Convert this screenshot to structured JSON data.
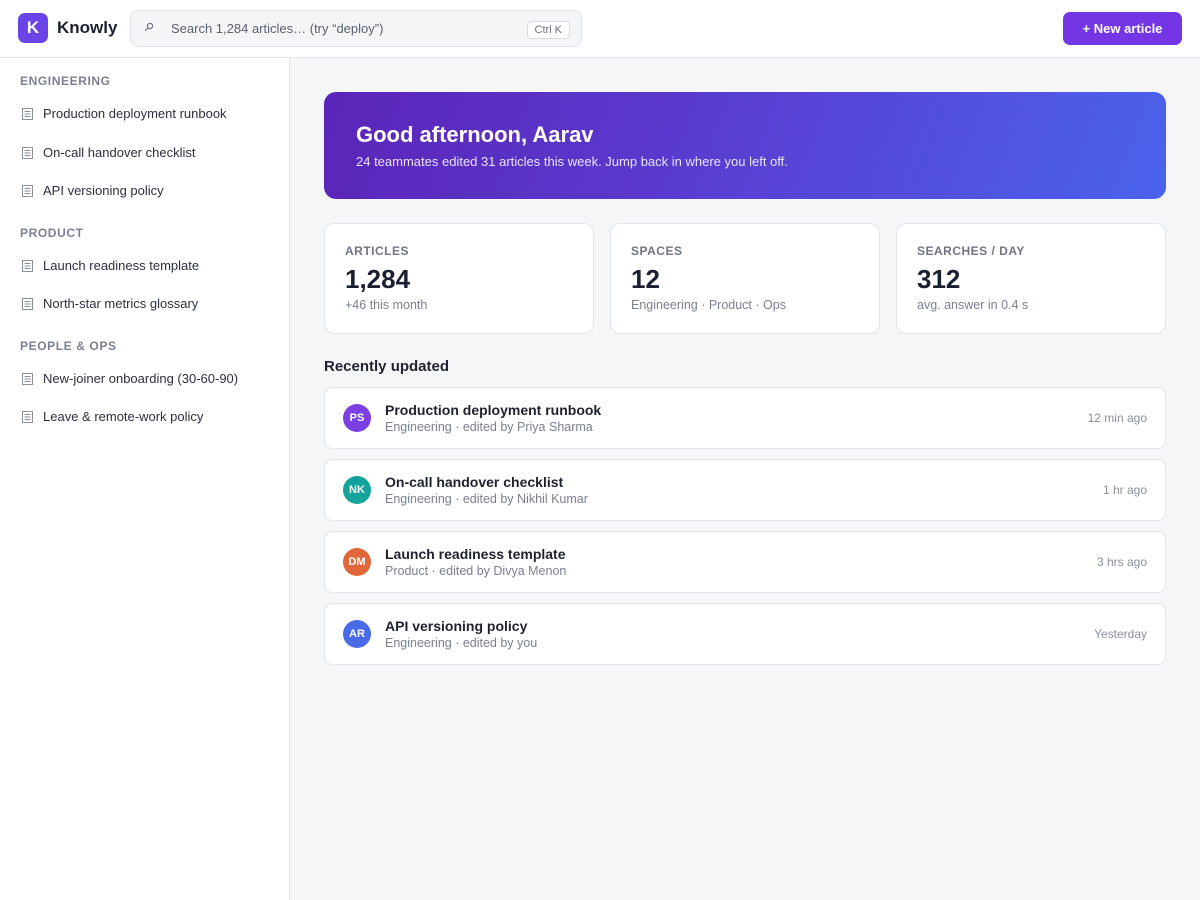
{
  "header": {
    "brand_initial": "K",
    "brand_name": "Knowly",
    "search_placeholder": "Search 1,284 articles…  (try “deploy”)",
    "search_shortcut": "Ctrl K",
    "new_article_label": "+ New article"
  },
  "sidebar": {
    "sections": [
      {
        "title": "ENGINEERING",
        "items": [
          "Production deployment runbook",
          "On-call handover checklist",
          "API versioning policy"
        ]
      },
      {
        "title": "PRODUCT",
        "items": [
          "Launch readiness template",
          "North-star metrics glossary"
        ]
      },
      {
        "title": "PEOPLE & OPS",
        "items": [
          "New-joiner onboarding (30-60-90)",
          "Leave & remote-work policy"
        ]
      }
    ]
  },
  "hero": {
    "title": "Good afternoon, Aarav",
    "subtitle": "24 teammates edited 31 articles this week. Jump back in where you left off."
  },
  "stats": [
    {
      "label": "ARTICLES",
      "value": "1,284",
      "sub": "+46 this month"
    },
    {
      "label": "SPACES",
      "value": "12",
      "sub": "Engineering · Product · Ops"
    },
    {
      "label": "SEARCHES / DAY",
      "value": "312",
      "sub": "avg. answer in 0.4 s"
    }
  ],
  "recent": {
    "title": "Recently updated",
    "rows": [
      {
        "initials": "PS",
        "color": "#7b3fe4",
        "title": "Production deployment runbook",
        "meta": "Engineering · edited by Priya Sharma",
        "time": "12 min ago"
      },
      {
        "initials": "NK",
        "color": "#12a39a",
        "title": "On-call handover checklist",
        "meta": "Engineering · edited by Nikhil Kumar",
        "time": "1 hr ago"
      },
      {
        "initials": "DM",
        "color": "#e0673a",
        "title": "Launch readiness template",
        "meta": "Product · edited by Divya Menon",
        "time": "3 hrs ago"
      },
      {
        "initials": "AR",
        "color": "#4a6be8",
        "title": "API versioning policy",
        "meta": "Engineering · edited by you",
        "time": "Yesterday"
      }
    ]
  },
  "icons": {
    "search": "search-icon",
    "document": "document-icon"
  }
}
